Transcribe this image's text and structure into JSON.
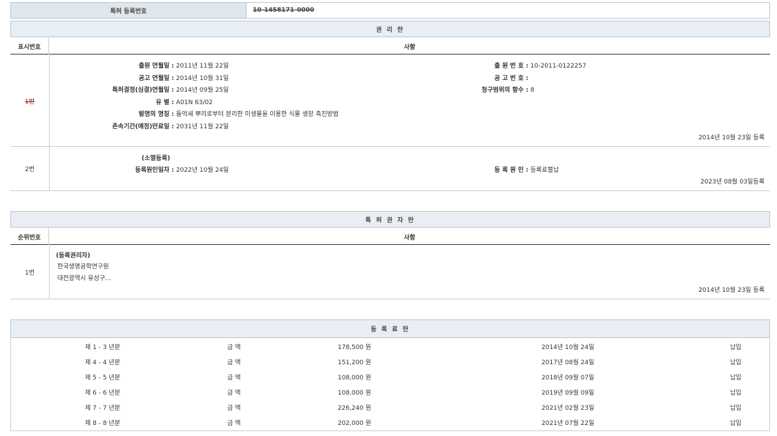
{
  "patent_header": {
    "label": "특허 등록번호",
    "number": "10-1458171-0000"
  },
  "rights_section": {
    "title": "권 리 란",
    "col_num": "표시번호",
    "col_matter": "사항",
    "row1": {
      "num": "1번",
      "filing_date_label": "출원 연월일 :",
      "filing_date": "2011년 11월 22일",
      "pub_date_label": "공고 연월일 :",
      "pub_date": "2014년 10월 31일",
      "decision_date_label": "특허결정(심결)연월일 :",
      "decision_date": "2014년 09월 25일",
      "class_label": "유 별 :",
      "class": "A01N 63/02",
      "title_label": "발명의 명칭 :",
      "title": "들억새 뿌리로부터 분리한 미생물을 이용한 식물 생장 촉진방법",
      "expiry_label": "존속기간(예정)만료일 :",
      "expiry": "2031년 11월 22일",
      "app_no_label": "출 원 번 호 :",
      "app_no": "10-2011-0122257",
      "pub_no_label": "공 고 번 호 :",
      "pub_no": "",
      "claims_label": "청구범위의 항수 :",
      "claims": "8",
      "reg_date": "2014년 10월 23일 등록"
    },
    "row2": {
      "num": "2번",
      "note": "(소멸등록)",
      "cause_date_label": "등록원인일자 :",
      "cause_date": "2022년 10월 24일",
      "cause_label": "등 록 원 인 :",
      "cause": "등록료불납",
      "reg_date": "2023년 08월 03일등록"
    }
  },
  "owner_section": {
    "title": "특 허 권 자 란",
    "col_num": "순위번호",
    "col_matter": "사항",
    "row1": {
      "num": "1번",
      "role": "(등록권리자)",
      "name": "한국생명공학연구원",
      "address": "대전광역시 유성구...",
      "reg_date": "2014년 10월 23일 등록"
    }
  },
  "fee_section": {
    "title": "등 록 료 란",
    "rows": [
      {
        "period": "제 1 - 3 년분",
        "label": "금 액",
        "amount": "178,500 원",
        "date": "2014년 10월 24일",
        "status": "납입"
      },
      {
        "period": "제 4 - 4 년분",
        "label": "금 액",
        "amount": "151,200 원",
        "date": "2017년 08월 24일",
        "status": "납입"
      },
      {
        "period": "제 5 - 5 년분",
        "label": "금 액",
        "amount": "108,000 원",
        "date": "2018년 09월 07일",
        "status": "납입"
      },
      {
        "period": "제 6 - 6 년분",
        "label": "금 액",
        "amount": "108,000 원",
        "date": "2019년 09월 09일",
        "status": "납입"
      },
      {
        "period": "제 7 - 7 년분",
        "label": "금 액",
        "amount": "226,240 원",
        "date": "2021년 02월 23일",
        "status": "납입"
      },
      {
        "period": "제 8 - 8 년분",
        "label": "금 액",
        "amount": "202,000 원",
        "date": "2021년 07월 22일",
        "status": "납입"
      }
    ]
  }
}
